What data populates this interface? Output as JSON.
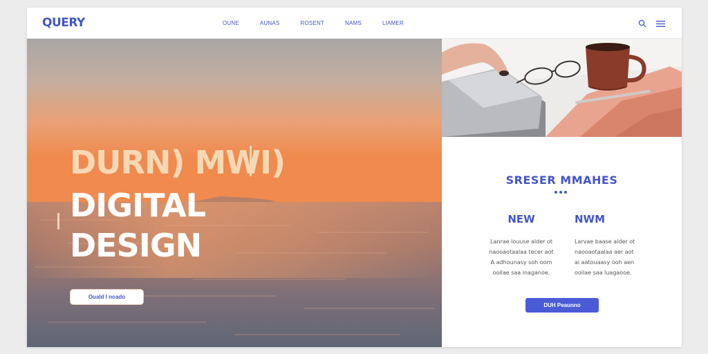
{
  "header": {
    "logo": "QUERY",
    "nav": [
      "OUNE",
      "AUNAS",
      "ROSENT",
      "NAMS",
      "LIAMER"
    ]
  },
  "hero": {
    "line1": "DURN) MWI)",
    "line2": "DIGITAL",
    "line3": "DESIGN",
    "button": "Ouald I noado"
  },
  "section": {
    "title": "SRESER MMAHES",
    "col1": {
      "title": "NEW",
      "lines": [
        "Lanrae louuse alder ot",
        "naooaotaalaa tecer aot",
        "A adhounasy soh oom",
        "ooilae saa inaganoe."
      ]
    },
    "col2": {
      "title": "NWM",
      "lines": [
        "Larvae baase alder ot",
        "naooaotaalaa aer aot",
        "ai aatouaasy ooh aen",
        "ooilae saa luagaooe."
      ]
    },
    "button": "DUH Peaunno"
  },
  "colors": {
    "brand": "#4455c8",
    "button": "#4a5bd6"
  },
  "icons": [
    "search-icon",
    "menu-icon"
  ]
}
